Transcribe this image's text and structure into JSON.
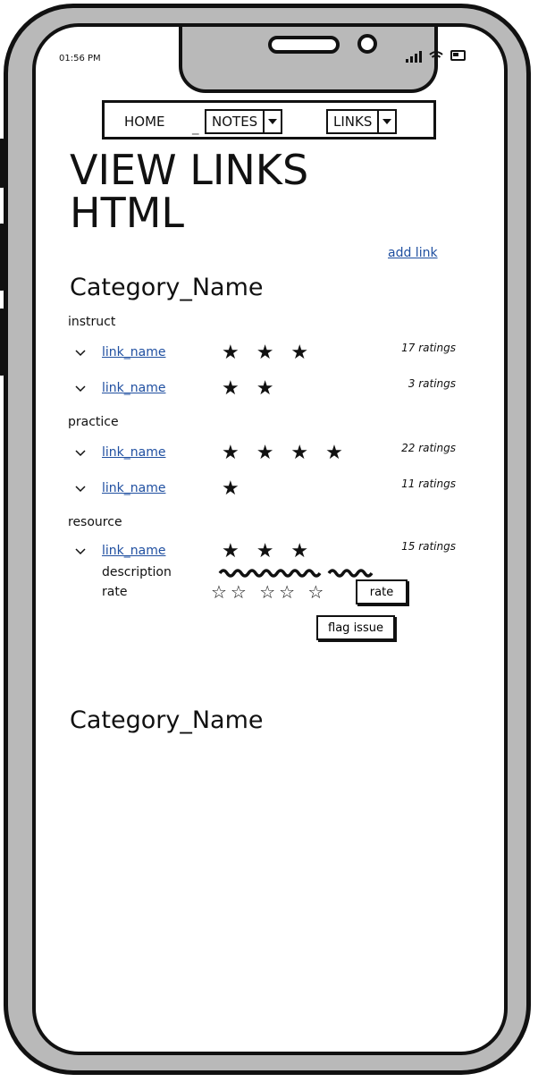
{
  "status": {
    "time": "01:56 PM"
  },
  "nav": {
    "home": "HOME",
    "notes": "NOTES",
    "links": "LINKS",
    "separator": "_"
  },
  "page_title_line1": "VIEW LINKS",
  "page_title_line2": "HTML",
  "add_link": "add link",
  "categories": [
    {
      "name": "Category_Name",
      "groups": [
        {
          "label": "instruct",
          "items": [
            {
              "link": "link_name",
              "stars": "★ ★ ★",
              "ratings": "17 ratings"
            },
            {
              "link": "link_name",
              "stars": "★ ★",
              "ratings": "3 ratings"
            }
          ]
        },
        {
          "label": "practice",
          "items": [
            {
              "link": "link_name",
              "stars": "★ ★ ★ ★",
              "ratings": "22 ratings"
            },
            {
              "link": "link_name",
              "stars": "★",
              "ratings": "11 ratings"
            }
          ]
        },
        {
          "label": "resource",
          "items": [
            {
              "link": "link_name",
              "stars": "★ ★ ★",
              "ratings": "15 ratings",
              "description_label": "description",
              "rate_label": "rate",
              "empty_stars": "☆☆ ☆☆ ☆",
              "rate_button": "rate",
              "flag_button": "flag issue"
            }
          ]
        }
      ]
    },
    {
      "name": "Category_Name"
    }
  ],
  "icons": {
    "chevron": "chevron-down-icon",
    "signal": "signal-icon",
    "wifi": "wifi-icon",
    "battery": "battery-icon"
  }
}
